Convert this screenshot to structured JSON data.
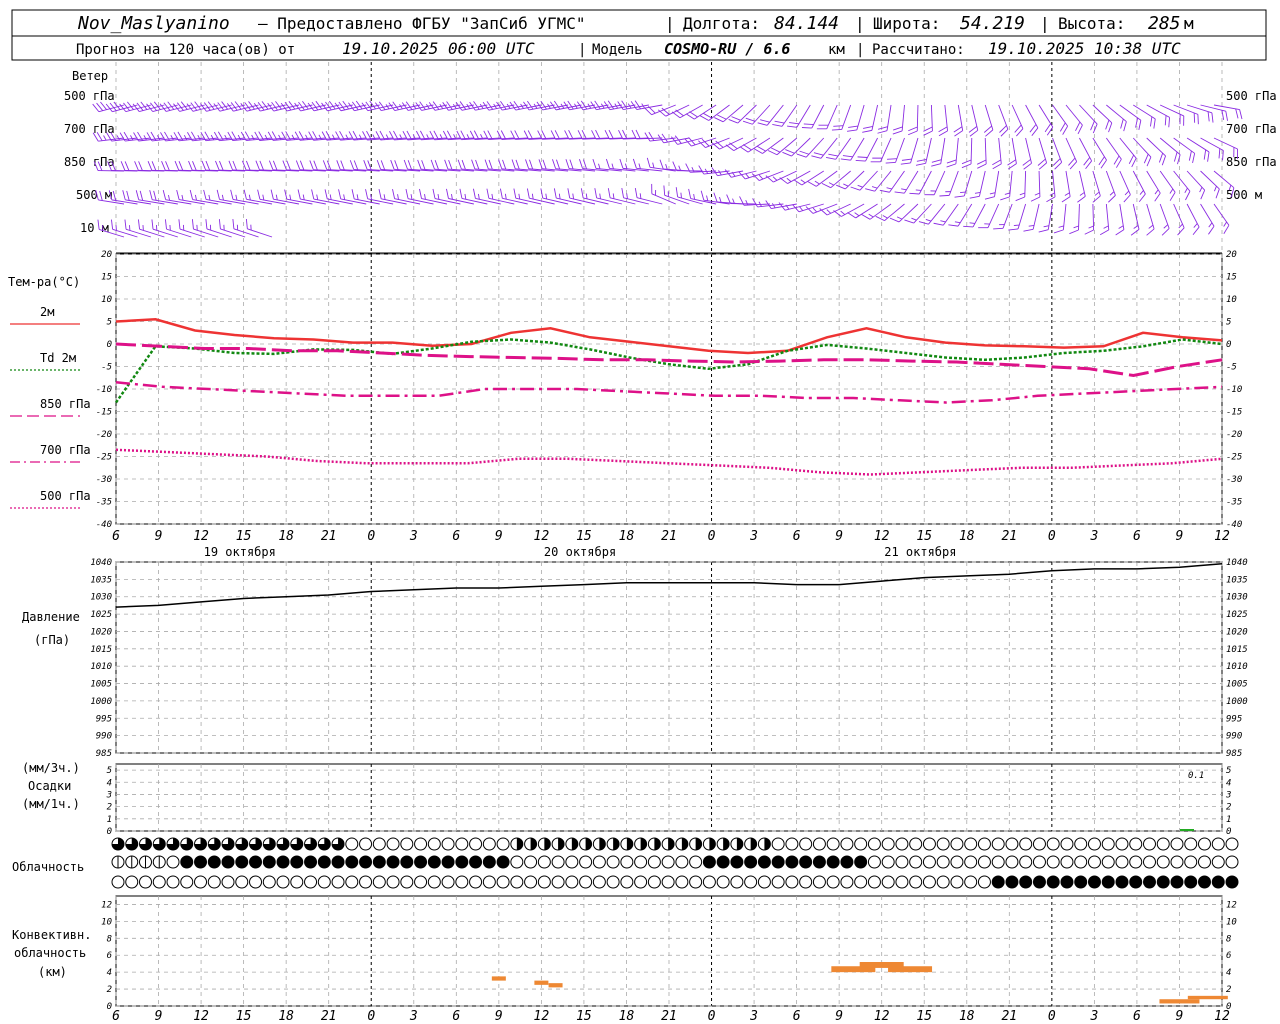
{
  "header": {
    "station": "Nov_Maslyanino",
    "provided": "— Предоставлено ФГБУ \"ЗапСиб УГМС\"",
    "lon_label": "Долгота:",
    "lon_value": "84.144",
    "lat_label": "Широта:",
    "lat_value": "54.219",
    "alt_label": "Высота:",
    "alt_value": "285",
    "alt_unit": "м",
    "forecast_label": "Прогноз на 120 часа(ов) от",
    "forecast_time": "19.10.2025 06:00 UTC",
    "model_label": "Модель",
    "model_name": "COSMO-RU / 6.6",
    "model_unit": "км",
    "computed_label": "Рассчитано:",
    "computed_time": "19.10.2025 10:38 UTC"
  },
  "wind": {
    "title": "Ветер",
    "levels": [
      "500 гПа",
      "700 гПа",
      "850 гПа",
      "500 м",
      "10 м"
    ],
    "color": "#8a2be2"
  },
  "temperature": {
    "title": "Тем-ра(°C)",
    "legend": [
      {
        "label": "2м",
        "color": "#ee3333",
        "style": "solid"
      },
      {
        "label": "Td 2м",
        "color": "#118811",
        "style": "dotted"
      },
      {
        "label": "850 гПа",
        "color": "#dd1188",
        "style": "dashed"
      },
      {
        "label": "700 гПа",
        "color": "#dd1188",
        "style": "dashdot"
      },
      {
        "label": "500 гПа",
        "color": "#dd1188",
        "style": "dotted"
      }
    ],
    "yticks": [
      "20",
      "15",
      "10",
      "5",
      "0",
      "-5",
      "-10",
      "-15",
      "-20",
      "-25",
      "-30",
      "-35",
      "-40"
    ]
  },
  "pressure": {
    "title": "Давление",
    "unit": "(гПа)",
    "yticks": [
      "1040",
      "1035",
      "1030",
      "1025",
      "1020",
      "1015",
      "1010",
      "1005",
      "1000",
      "995",
      "990",
      "985"
    ]
  },
  "precip": {
    "unit1": "(мм/3ч.)",
    "title": "Осадки",
    "unit2": "(мм/1ч.)",
    "yticks": [
      "5",
      "4",
      "3",
      "2",
      "1",
      "0"
    ],
    "annotation": "0.1"
  },
  "clouds": {
    "title": "Облачность"
  },
  "convective": {
    "title1": "Конвективн.",
    "title2": "облачность",
    "unit": "(км)",
    "yticks": [
      "12",
      "10",
      "8",
      "6",
      "4",
      "2",
      "0"
    ],
    "color": "#ee8833"
  },
  "xaxis": {
    "hour_ticks": [
      "6",
      "9",
      "12",
      "15",
      "18",
      "21",
      "0",
      "3",
      "6",
      "9",
      "12",
      "15",
      "18",
      "21",
      "0",
      "3",
      "6",
      "9",
      "12",
      "15",
      "18",
      "21",
      "0",
      "3",
      "6",
      "9",
      "12"
    ],
    "days": [
      "19 октября",
      "20 октября",
      "21 октября"
    ]
  },
  "chart_data": [
    {
      "type": "line",
      "title": "Тем-ра(°C)",
      "x_hours_from_start": [
        0,
        3,
        6,
        9,
        12,
        15,
        18,
        21,
        24,
        27,
        30,
        33,
        36,
        39,
        42,
        45,
        48,
        51,
        54,
        57,
        60,
        63,
        66,
        69,
        72,
        75,
        78
      ],
      "ylim": [
        -40,
        20
      ],
      "series": [
        {
          "name": "2м",
          "values": [
            5,
            5.5,
            3,
            2,
            1.3,
            1,
            0.3,
            0.3,
            -0.4,
            0,
            2.5,
            3.5,
            1.5,
            0.5,
            -0.5,
            -1.5,
            -2,
            -1.5,
            1.5,
            3.5,
            1.5,
            0.3,
            -0.3,
            -0.5,
            -0.8,
            -0.5,
            2.5,
            1.5,
            0.8
          ]
        },
        {
          "name": "Td 2м",
          "values": [
            -13,
            -0.5,
            -1,
            -2,
            -2.2,
            -1.2,
            -1.3,
            -2.2,
            -1,
            0.5,
            1,
            0.3,
            -1.2,
            -3,
            -4.5,
            -5.5,
            -4.5,
            -1.5,
            -0.2,
            -1,
            -2,
            -3,
            -3.5,
            -3,
            -2,
            -1.5,
            -0.5,
            1,
            0
          ]
        },
        {
          "name": "850 гПа",
          "values": [
            0,
            -0.5,
            -1,
            -1,
            -1.5,
            -1.5,
            -2,
            -2.5,
            -2.8,
            -3,
            -3.2,
            -3.5,
            -3.5,
            -3.8,
            -4,
            -3.8,
            -3.5,
            -3.5,
            -3.8,
            -4,
            -4.5,
            -5,
            -5.5,
            -7,
            -5,
            -3.5
          ]
        },
        {
          "name": "700 гПа",
          "values": [
            -8.5,
            -9.5,
            -10,
            -10.5,
            -11,
            -11.5,
            -11.5,
            -11.5,
            -10,
            -10,
            -10,
            -10.5,
            -11,
            -11.5,
            -11.5,
            -12,
            -12,
            -12.5,
            -13,
            -12.5,
            -11.5,
            -11,
            -10.5,
            -10,
            -9.5
          ]
        },
        {
          "name": "500 гПа",
          "values": [
            -23.5,
            -24,
            -24.5,
            -25,
            -26,
            -26.5,
            -26.5,
            -26.5,
            -25.5,
            -25.5,
            -26,
            -26.5,
            -27,
            -27.5,
            -28.5,
            -29,
            -28.5,
            -28,
            -27.5,
            -27.5,
            -27,
            -26.5,
            -25.5
          ]
        }
      ]
    },
    {
      "type": "line",
      "title": "Давление",
      "ylabel": "(гПа)",
      "ylim": [
        985,
        1040
      ],
      "series": [
        {
          "name": "",
          "values": [
            1027,
            1027.5,
            1028.5,
            1029.5,
            1030,
            1030.5,
            1031.5,
            1032,
            1032.5,
            1032.5,
            1033,
            1033.5,
            1034,
            1034,
            1034,
            1034,
            1033.5,
            1033.5,
            1034.5,
            1035.5,
            1036,
            1036.5,
            1037.5,
            1038,
            1038,
            1038.5,
            1039.5
          ]
        }
      ]
    },
    {
      "type": "bar",
      "title": "Конвективн. облачность",
      "ylabel": "(км)",
      "ylim": [
        0,
        12
      ],
      "series": [
        {
          "name": "",
          "values": [
            {
              "x_hour": 27,
              "base": 3.0,
              "top": 3.5
            },
            {
              "x_hour": 30,
              "base": 2.5,
              "top": 3.0
            },
            {
              "x_hour": 31,
              "base": 2.2,
              "top": 2.7
            },
            {
              "x_hour": 52,
              "base": 4.0,
              "top": 4.7
            },
            {
              "x_hour": 54,
              "base": 4.5,
              "top": 5.2
            },
            {
              "x_hour": 56,
              "base": 4.0,
              "top": 4.7
            },
            {
              "x_hour": 75,
              "base": 0.3,
              "top": 0.8
            },
            {
              "x_hour": 77,
              "base": 0.8,
              "top": 1.2
            }
          ]
        }
      ]
    }
  ]
}
